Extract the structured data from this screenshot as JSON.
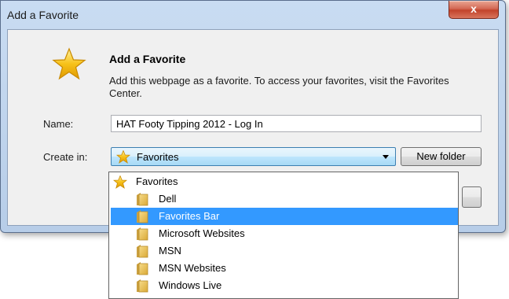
{
  "window": {
    "title": "Add a Favorite",
    "close_label": "x"
  },
  "header": {
    "title": "Add a Favorite",
    "description": "Add this webpage as a favorite. To access your favorites, visit the Favorites Center."
  },
  "form": {
    "name_label": "Name:",
    "name_value": "HAT Footy Tipping 2012 - Log In",
    "create_in_label": "Create in:",
    "create_in_value": "Favorites",
    "new_folder_label": "New folder"
  },
  "dropdown": {
    "root": "Favorites",
    "items": [
      "Dell",
      "Favorites Bar",
      "Microsoft Websites",
      "MSN",
      "MSN Websites",
      "Windows Live"
    ],
    "selected_item": "Favorites Bar"
  },
  "colors": {
    "selection": "#3399ff",
    "star": "#f7c21a",
    "folder": "#e8c15c"
  }
}
